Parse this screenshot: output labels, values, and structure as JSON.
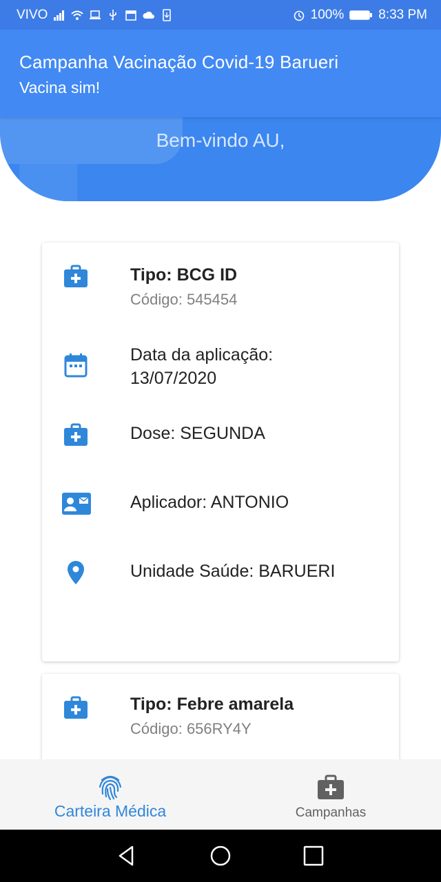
{
  "status_bar": {
    "carrier": "VIVO",
    "battery": "100%",
    "time": "8:33 PM",
    "icons": [
      "signal-icon",
      "wifi-icon",
      "laptop-icon",
      "usb-icon",
      "calendar-icon",
      "cloud-icon",
      "phone-download-icon",
      "alarm-icon",
      "battery-icon"
    ]
  },
  "app_bar": {
    "title": "Campanha Vacinação Covid-19 Barueri",
    "subtitle": "Vacina sim!"
  },
  "header": {
    "welcome": "Bem-vindo AU,"
  },
  "cards": [
    {
      "type": "Tipo: BCG ID",
      "code": "Código: 545454",
      "date_label": "Data da aplicação:",
      "date_value": "13/07/2020",
      "dose": "Dose: SEGUNDA",
      "applicator": "Aplicador: ANTONIO",
      "unit": "Unidade Saúde: BARUERI"
    },
    {
      "type": "Tipo: Febre amarela",
      "code": "Código: 656RY4Y"
    }
  ],
  "bottom_nav": {
    "items": [
      {
        "label": "Carteira Médica",
        "icon": "fingerprint-icon",
        "active": true
      },
      {
        "label": "Campanhas",
        "icon": "medical-kit-icon",
        "active": false
      }
    ]
  },
  "colors": {
    "primary": "#4289f4",
    "status_bar": "#3d7ce6",
    "header": "#3b86ef",
    "icon_blue": "#2f87da",
    "nav_inactive": "#616161"
  }
}
